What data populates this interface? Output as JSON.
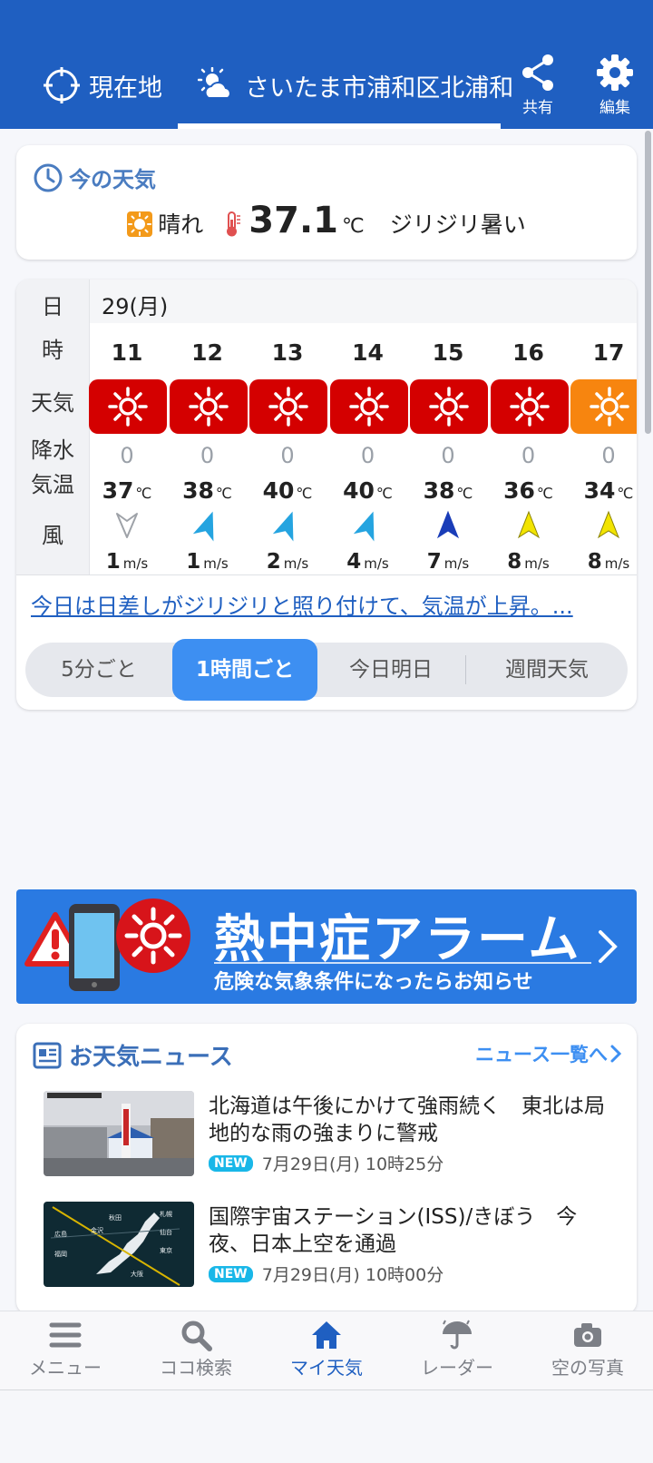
{
  "header": {
    "tabs": [
      {
        "label": "現在地",
        "icon": "crosshair-icon"
      },
      {
        "label": "さいたま市浦和区北浦和",
        "icon": "sun-cloud-icon",
        "selected": true
      }
    ],
    "share_label": "共有",
    "edit_label": "編集"
  },
  "now": {
    "title": "今の天気",
    "condition": "晴れ",
    "temp": "37.1",
    "unit": "℃",
    "description": "ジリジリ暑い"
  },
  "forecast": {
    "labels": {
      "day": "日",
      "hour": "時",
      "weather": "天気",
      "precip": "降水",
      "temp": "気温",
      "wind": "風"
    },
    "day": "29(月)",
    "hours": [
      {
        "hour": "11",
        "precip": "0",
        "temp": "37",
        "temp_unit": "℃",
        "wind": "1",
        "wind_unit": "m/s",
        "wind_color": "#cfd2d6"
      },
      {
        "hour": "12",
        "precip": "0",
        "temp": "38",
        "temp_unit": "℃",
        "wind": "1",
        "wind_unit": "m/s",
        "wind_color": "#25a4e0"
      },
      {
        "hour": "13",
        "precip": "0",
        "temp": "40",
        "temp_unit": "℃",
        "wind": "2",
        "wind_unit": "m/s",
        "wind_color": "#25a4e0"
      },
      {
        "hour": "14",
        "precip": "0",
        "temp": "40",
        "temp_unit": "℃",
        "wind": "4",
        "wind_unit": "m/s",
        "wind_color": "#25a4e0"
      },
      {
        "hour": "15",
        "precip": "0",
        "temp": "38",
        "temp_unit": "℃",
        "wind": "7",
        "wind_unit": "m/s",
        "wind_color": "#1a3db8"
      },
      {
        "hour": "16",
        "precip": "0",
        "temp": "36",
        "temp_unit": "℃",
        "wind": "8",
        "wind_unit": "m/s",
        "wind_color": "#f2e400"
      },
      {
        "hour": "17",
        "precip": "0",
        "temp": "34",
        "temp_unit": "℃",
        "wind": "8",
        "wind_unit": "m/s",
        "wind_color": "#f2e400"
      }
    ],
    "summary": "今日は日差しがジリジリと照り付けて、気温が上昇。...",
    "segments": [
      "5分ごと",
      "1時間ごと",
      "今日明日",
      "週間天気"
    ],
    "active_segment": "1時間ごと"
  },
  "banner": {
    "title": "熱中症アラーム",
    "subtitle": "危険な気象条件になったらお知らせ"
  },
  "news": {
    "title": "お天気ニュース",
    "more_label": "ニュース一覧へ",
    "items": [
      {
        "headline": "北海道は午後にかけて強雨続く　東北は局地的な雨の強まりに警戒",
        "badge": "NEW",
        "time": "7月29日(月) 10時25分"
      },
      {
        "headline": "国際宇宙ステーション(ISS)/きぼう　今夜、日本上空を通過",
        "badge": "NEW",
        "time": "7月29日(月) 10時00分"
      }
    ]
  },
  "bottom_nav": [
    {
      "label": "メニュー",
      "icon": "menu-icon"
    },
    {
      "label": "ココ検索",
      "icon": "search-icon"
    },
    {
      "label": "マイ天気",
      "icon": "home-icon",
      "active": true
    },
    {
      "label": "レーダー",
      "icon": "umbrella-icon"
    },
    {
      "label": "空の写真",
      "icon": "camera-icon"
    }
  ],
  "colors": {
    "header_bg": "#1f5fc1",
    "weather_tile": "#d40000",
    "weather_tile_partial": "#f7850f",
    "accent": "#3d8ff2",
    "banner_bg": "#2a7ae2"
  }
}
